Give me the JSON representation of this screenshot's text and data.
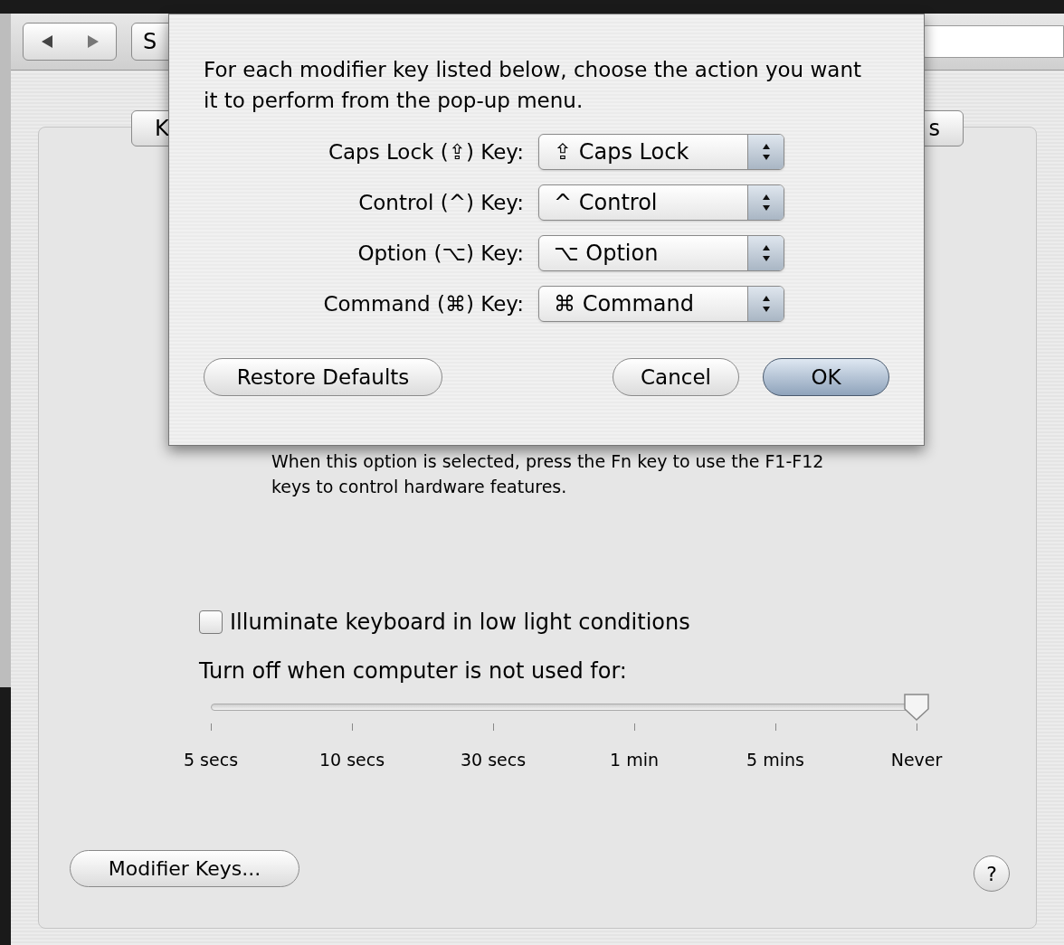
{
  "toolbar": {
    "show_all": "S"
  },
  "tab_bar": {
    "first_visible": "K",
    "last_visible": "s"
  },
  "sheet": {
    "message": "For each modifier key listed below, choose the action you want it to perform from the pop-up menu.",
    "rows": [
      {
        "label": "Caps Lock (⇪) Key:",
        "value": "⇪ Caps Lock"
      },
      {
        "label": "Control (^) Key:",
        "value": "^ Control"
      },
      {
        "label": "Option (⌥) Key:",
        "value": "⌥ Option"
      },
      {
        "label": "Command (⌘) Key:",
        "value": "⌘ Command"
      }
    ],
    "restore_button": "Restore Defaults",
    "buttons": [
      {
        "label": "Cancel",
        "kind": "normal"
      },
      {
        "label": "OK",
        "kind": "default"
      }
    ]
  },
  "fn_description": "When this option is selected, press the Fn key to use the F1-F12 keys to control hardware features.",
  "illuminate": {
    "label": "Illuminate keyboard in low light conditions",
    "checked": false
  },
  "turn_off": {
    "label": "Turn off when computer is not used for:",
    "level": 1,
    "ticks": [
      "5 secs",
      "10 secs",
      "30 secs",
      "1 min",
      "5 mins",
      "Never"
    ]
  },
  "modifier_button": "Modifier Keys...",
  "help_button": "?"
}
